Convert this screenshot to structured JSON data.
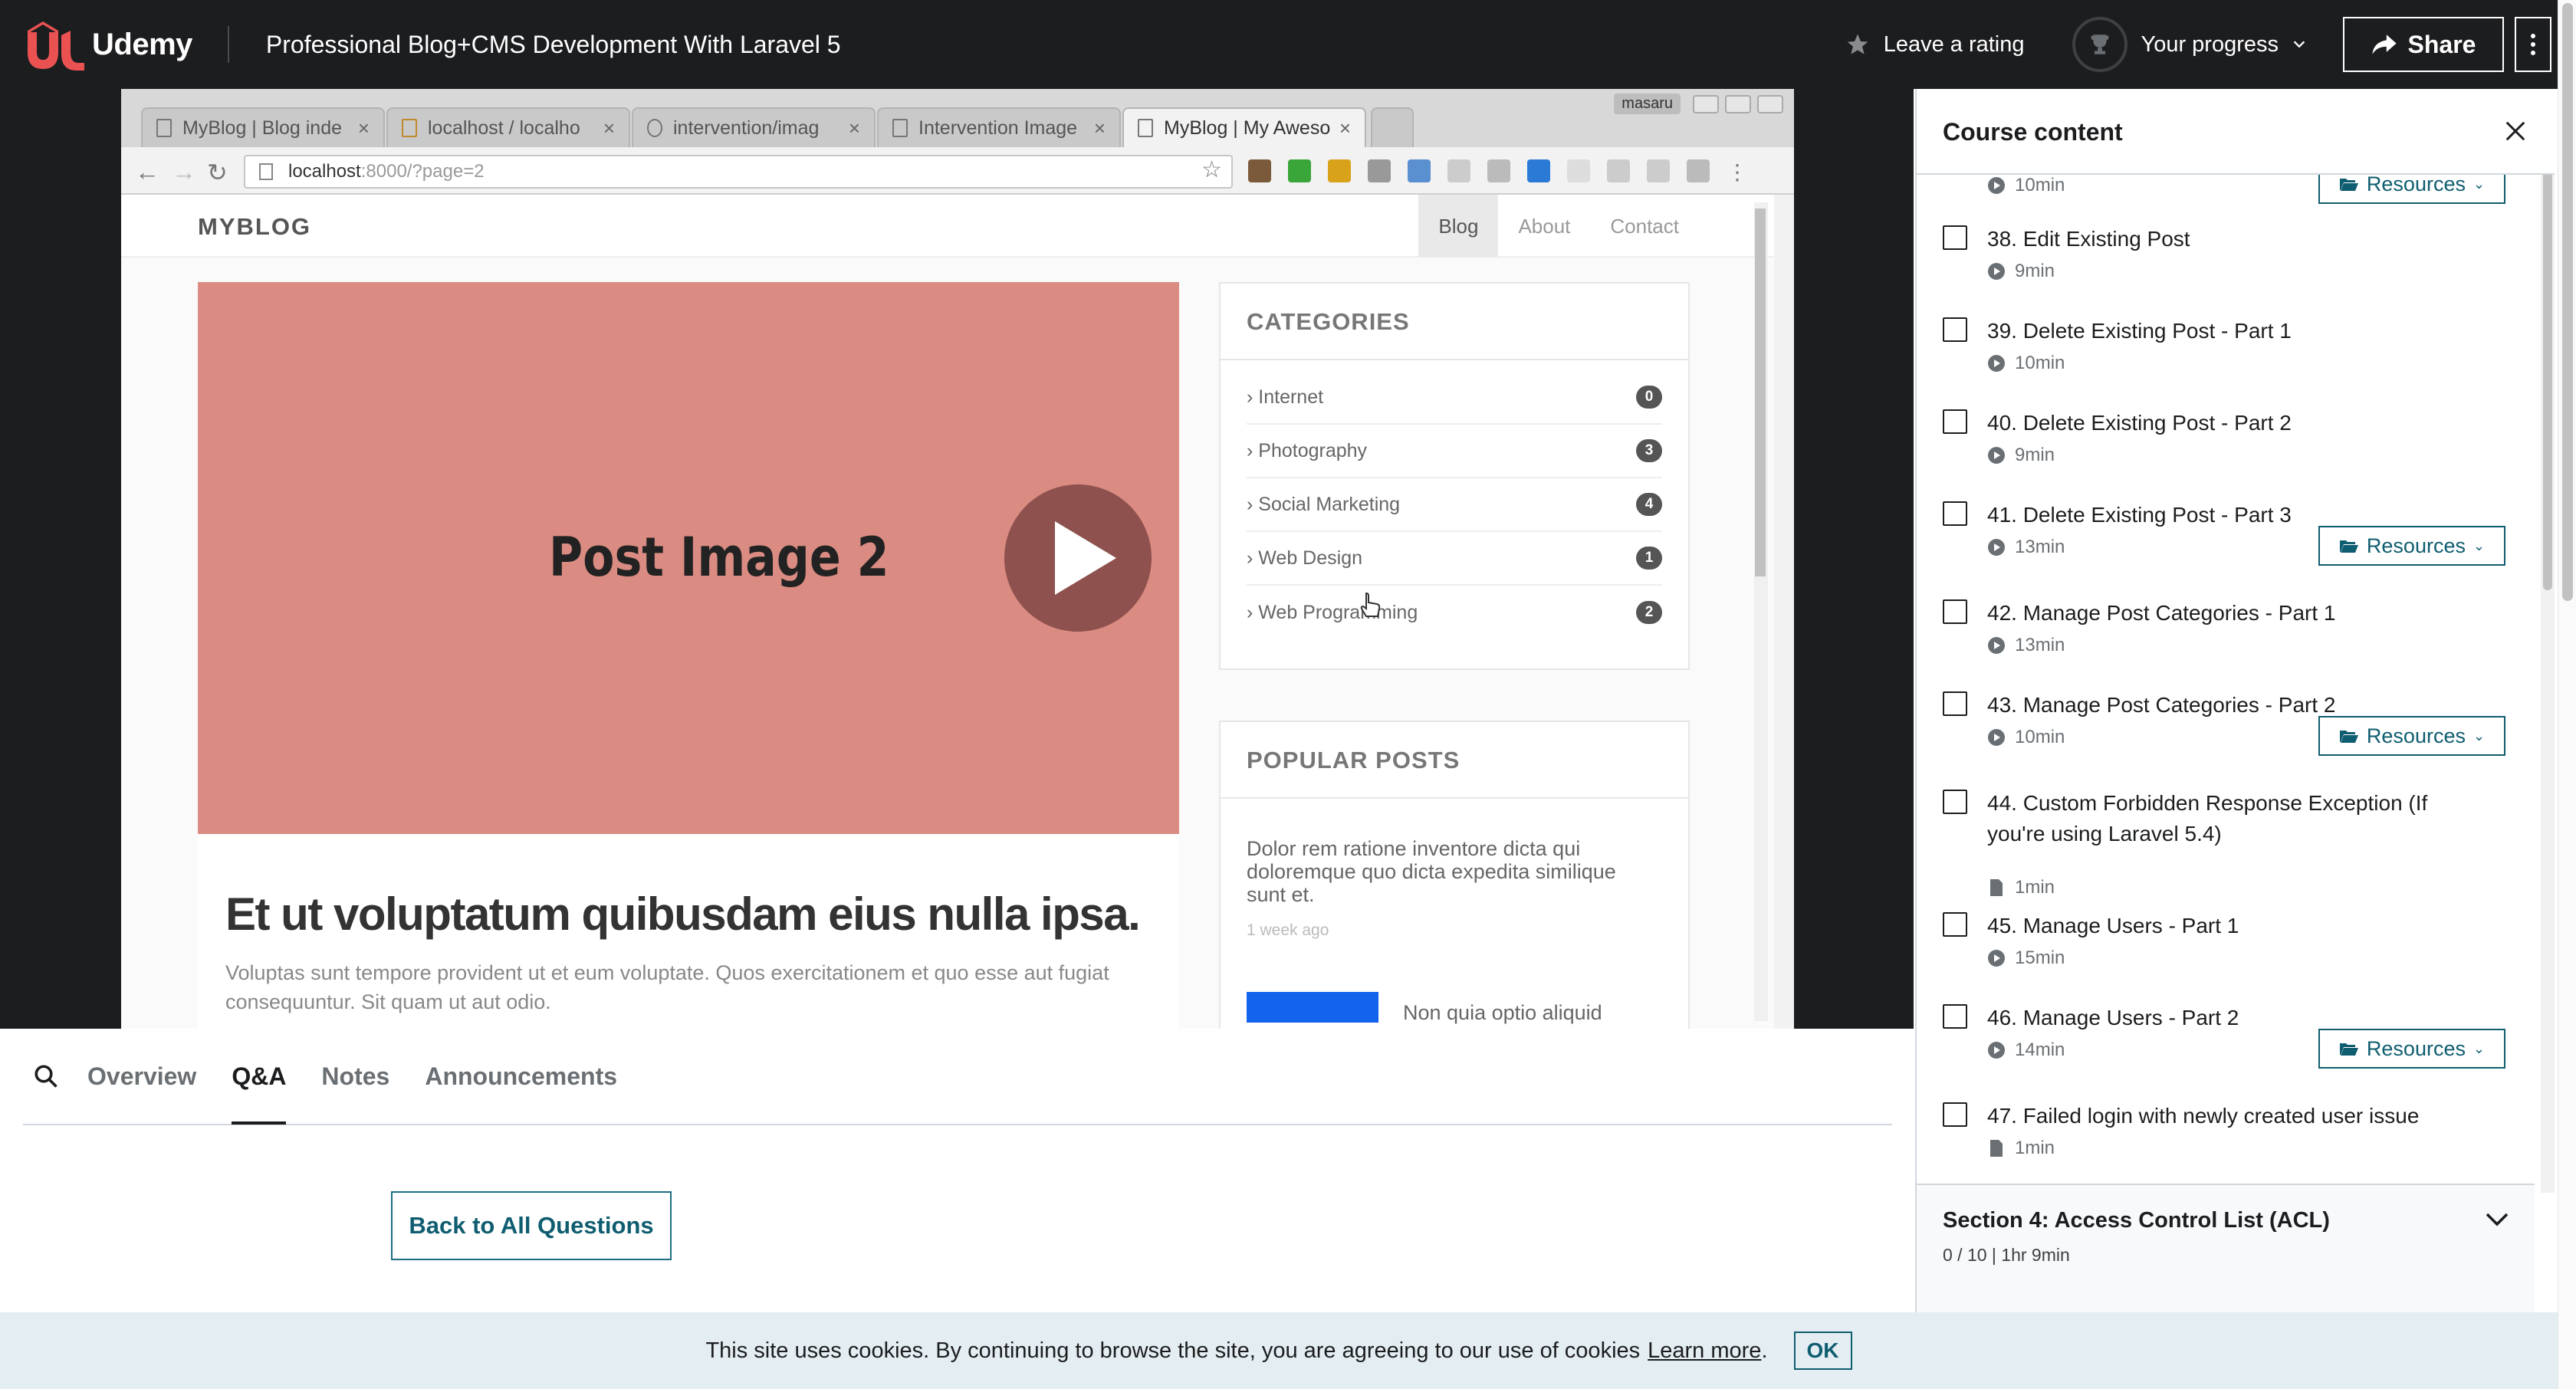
{
  "topbar": {
    "logo_text": "Udemy",
    "course_title": "Professional Blog+CMS Development With Laravel 5",
    "rating_label": "Leave a rating",
    "progress_label": "Your progress",
    "share_label": "Share"
  },
  "browser": {
    "tabs": [
      {
        "label": "MyBlog | Blog inde",
        "active": false
      },
      {
        "label": "localhost / localho",
        "active": false
      },
      {
        "label": "intervention/imag",
        "active": false
      },
      {
        "label": "Intervention Image",
        "active": false
      },
      {
        "label": "MyBlog | My Aweso",
        "active": true
      }
    ],
    "window_user": "masaru",
    "url_host": "localhost",
    "url_rest": ":8000/?page=2"
  },
  "blog": {
    "brand": "MYBLOG",
    "nav": [
      "Blog",
      "About",
      "Contact"
    ],
    "post_image_text": "Post Image 2",
    "post_title": "Et ut voluptatum quibusdam eius nulla ipsa.",
    "post_excerpt": "Voluptas sunt tempore provident ut et eum voluptate. Quos exercitationem et quo esse aut fugiat consequuntur. Sit quam ut aut odio.",
    "categories_title": "CATEGORIES",
    "categories": [
      {
        "name": "Internet",
        "count": "0"
      },
      {
        "name": "Photography",
        "count": "3"
      },
      {
        "name": "Social Marketing",
        "count": "4"
      },
      {
        "name": "Web Design",
        "count": "1"
      },
      {
        "name": "Web Programming",
        "count": "2"
      }
    ],
    "popular_title": "POPULAR POSTS",
    "popular_text": "Dolor rem ratione inventore dicta qui doloremque quo dicta expedita similique sunt et.",
    "popular_date": "1 week ago",
    "popular_next": "Non quia optio aliquid"
  },
  "tabs": {
    "items": [
      "Overview",
      "Q&A",
      "Notes",
      "Announcements"
    ],
    "active": "Q&A",
    "back_label": "Back to All Questions"
  },
  "sidebar": {
    "title": "Course content",
    "resources_label": "Resources",
    "lectures": [
      {
        "title": "",
        "duration": "10min",
        "type": "video",
        "resources": true
      },
      {
        "title": "38. Edit Existing Post",
        "duration": "9min",
        "type": "video",
        "resources": false
      },
      {
        "title": "39. Delete Existing Post - Part 1",
        "duration": "10min",
        "type": "video",
        "resources": false
      },
      {
        "title": "40. Delete Existing Post - Part 2",
        "duration": "9min",
        "type": "video",
        "resources": false
      },
      {
        "title": "41. Delete Existing Post - Part 3",
        "duration": "13min",
        "type": "video",
        "resources": true
      },
      {
        "title": "42. Manage Post Categories - Part 1",
        "duration": "13min",
        "type": "video",
        "resources": false
      },
      {
        "title": "43. Manage Post Categories - Part 2",
        "duration": "10min",
        "type": "video",
        "resources": true
      },
      {
        "title": "44. Custom Forbidden Response Exception (If you're using Laravel 5.4)",
        "duration": "1min",
        "type": "article",
        "resources": false
      },
      {
        "title": "45. Manage Users - Part 1",
        "duration": "15min",
        "type": "video",
        "resources": false
      },
      {
        "title": "46. Manage Users - Part 2",
        "duration": "14min",
        "type": "video",
        "resources": true
      },
      {
        "title": "47. Failed login with newly created user issue",
        "duration": "1min",
        "type": "article",
        "resources": false
      }
    ],
    "section": {
      "title": "Section 4: Access Control List (ACL)",
      "meta": "0 / 10 | 1hr 9min"
    }
  },
  "cookie": {
    "text": "This site uses cookies. By continuing to browse the site, you are agreeing to our use of cookies",
    "learn_more": "Learn more",
    "period": ".",
    "ok_label": "OK"
  },
  "colors": {
    "topbar_bg": "#1c1d1f",
    "brand_red": "#ea5252",
    "teal": "#0f5d70",
    "post_image": "#da8b82",
    "cookie_bg": "#e4edf1"
  }
}
